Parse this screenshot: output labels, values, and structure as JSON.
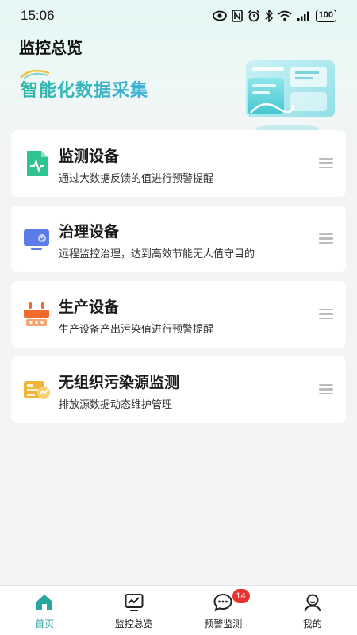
{
  "status_bar": {
    "time": "15:06",
    "battery": "100",
    "icons": [
      "eye-icon",
      "nfc-icon",
      "alarm-icon",
      "bluetooth-icon",
      "wifi-icon",
      "signal-icon",
      "battery-icon"
    ]
  },
  "header": {
    "title": "监控总览"
  },
  "banner": {
    "title": "智能化数据采集"
  },
  "cards": [
    {
      "title": "监测设备",
      "desc": "通过大数据反馈的值进行预警提醒",
      "icon": "monitor-doc-icon"
    },
    {
      "title": "治理设备",
      "desc": "远程监控治理，达到高效节能无人值守目的",
      "icon": "screen-device-icon"
    },
    {
      "title": "生产设备",
      "desc": "生产设备产出污染值进行预警提醒",
      "icon": "production-device-icon"
    },
    {
      "title": "无组织污染源监测",
      "desc": "排放源数据动态维护管理",
      "icon": "pollution-source-icon"
    }
  ],
  "tabbar": {
    "items": [
      {
        "label": "首页",
        "icon": "home-icon",
        "active": true
      },
      {
        "label": "监控总览",
        "icon": "chart-monitor-icon",
        "active": false
      },
      {
        "label": "预警监测",
        "icon": "chat-alert-icon",
        "active": false,
        "badge": "14"
      },
      {
        "label": "我的",
        "icon": "user-icon",
        "active": false
      }
    ]
  },
  "colors": {
    "accent": "#2aa6a0",
    "badge": "#e8322f",
    "card_icon_green": "#2ec48f",
    "card_icon_blue": "#5b7be8",
    "card_icon_orange": "#f06a2b",
    "card_icon_yellow": "#f2b43a"
  }
}
